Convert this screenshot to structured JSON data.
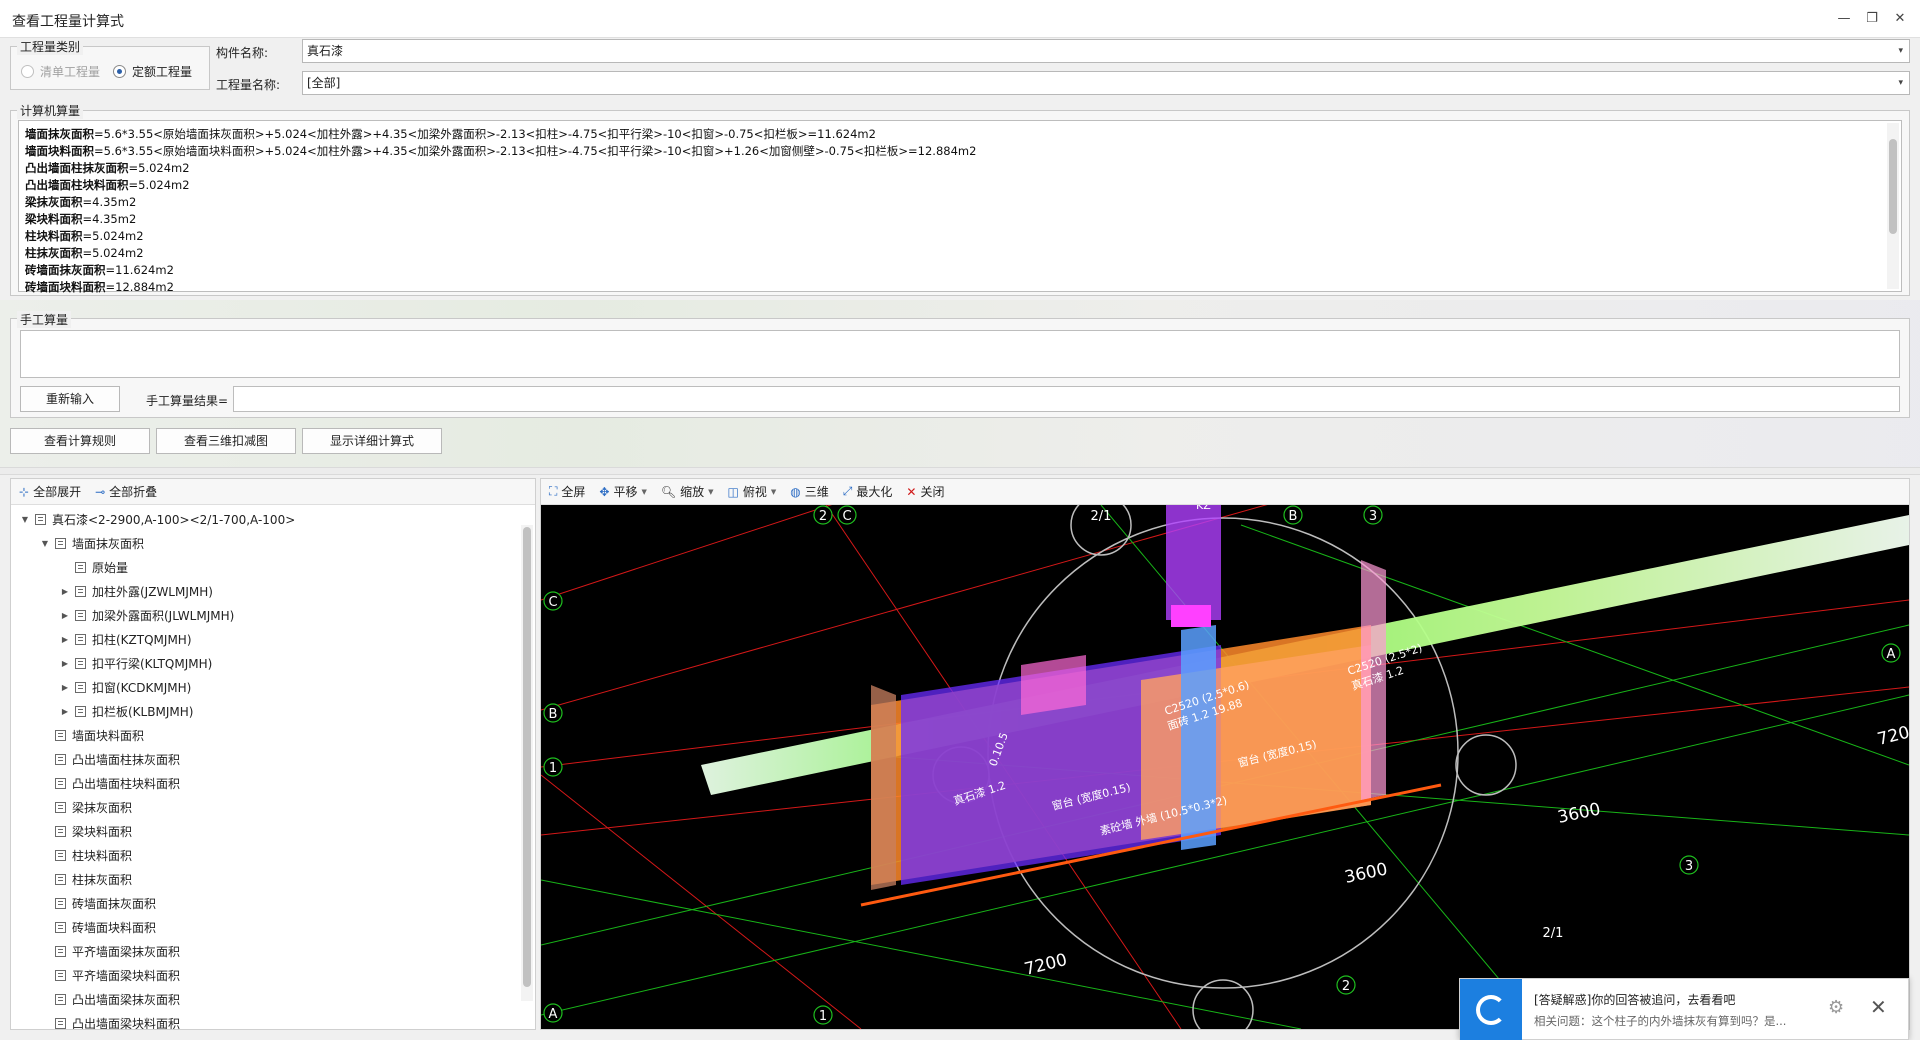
{
  "window": {
    "title": "查看工程量计算式",
    "minimize": "—",
    "restore": "❐",
    "close": "✕"
  },
  "category": {
    "label": "工程量类别",
    "options": [
      {
        "label": "清单工程量",
        "checked": false,
        "enabled": false
      },
      {
        "label": "定额工程量",
        "checked": true,
        "enabled": true
      }
    ]
  },
  "component": {
    "name_label": "构件名称:",
    "name_value": "真石漆",
    "quantity_label": "工程量名称:",
    "quantity_value": "[全部]"
  },
  "computer_calc": {
    "label": "计算机算量",
    "lines": [
      {
        "name": "墙面抹灰面积",
        "expr": "=5.6*3.55<原始墙面抹灰面积>+5.024<加柱外露>+4.35<加梁外露面积>-2.13<扣柱>-4.75<扣平行梁>-10<扣窗>-0.75<扣栏板>=11.624m2"
      },
      {
        "name": "墙面块料面积",
        "expr": "=5.6*3.55<原始墙面块料面积>+5.024<加柱外露>+4.35<加梁外露面积>-2.13<扣柱>-4.75<扣平行梁>-10<扣窗>+1.26<加窗侧壁>-0.75<扣栏板>=12.884m2"
      },
      {
        "name": "凸出墙面柱抹灰面积",
        "expr": "=5.024m2"
      },
      {
        "name": "凸出墙面柱块料面积",
        "expr": "=5.024m2"
      },
      {
        "name": "梁抹灰面积",
        "expr": "=4.35m2"
      },
      {
        "name": "梁块料面积",
        "expr": "=4.35m2"
      },
      {
        "name": "柱块料面积",
        "expr": "=5.024m2"
      },
      {
        "name": "柱抹灰面积",
        "expr": "=5.024m2"
      },
      {
        "name": "砖墙面抹灰面积",
        "expr": "=11.624m2"
      },
      {
        "name": "砖墙面块料面积",
        "expr": "=12.884m2"
      }
    ]
  },
  "manual_calc": {
    "label": "手工算量",
    "reenter": "重新输入",
    "result_label": "手工算量结果="
  },
  "actions": {
    "rules": "查看计算规则",
    "view3d": "查看三维扣减图",
    "detail": "显示详细计算式"
  },
  "tree_toolbar": {
    "expand": "全部展开",
    "collapse": "全部折叠"
  },
  "tree": [
    {
      "label": "真石漆<2-2900,A-100><2/1-700,A-100>",
      "level": 0,
      "expander": "▼"
    },
    {
      "label": "墙面抹灰面积",
      "level": 1,
      "expander": "▼"
    },
    {
      "label": "原始量",
      "level": 2,
      "expander": ""
    },
    {
      "label": "加柱外露(JZWLMJMH)",
      "level": 2,
      "expander": "▶"
    },
    {
      "label": "加梁外露面积(JLWLMJMH)",
      "level": 2,
      "expander": "▶"
    },
    {
      "label": "扣柱(KZTQMJMH)",
      "level": 2,
      "expander": "▶"
    },
    {
      "label": "扣平行梁(KLTQMJMH)",
      "level": 2,
      "expander": "▶"
    },
    {
      "label": "扣窗(KCDKMJMH)",
      "level": 2,
      "expander": "▶"
    },
    {
      "label": "扣栏板(KLBMJMH)",
      "level": 2,
      "expander": "▶"
    },
    {
      "label": "墙面块料面积",
      "level": 1,
      "expander": ""
    },
    {
      "label": "凸出墙面柱抹灰面积",
      "level": 1,
      "expander": ""
    },
    {
      "label": "凸出墙面柱块料面积",
      "level": 1,
      "expander": ""
    },
    {
      "label": "梁抹灰面积",
      "level": 1,
      "expander": ""
    },
    {
      "label": "梁块料面积",
      "level": 1,
      "expander": ""
    },
    {
      "label": "柱块料面积",
      "level": 1,
      "expander": ""
    },
    {
      "label": "柱抹灰面积",
      "level": 1,
      "expander": ""
    },
    {
      "label": "砖墙面抹灰面积",
      "level": 1,
      "expander": ""
    },
    {
      "label": "砖墙面块料面积",
      "level": 1,
      "expander": ""
    },
    {
      "label": "平齐墙面梁抹灰面积",
      "level": 1,
      "expander": ""
    },
    {
      "label": "平齐墙面梁块料面积",
      "level": 1,
      "expander": ""
    },
    {
      "label": "凸出墙面梁抹灰面积",
      "level": 1,
      "expander": ""
    },
    {
      "label": "凸出墙面梁块料面积",
      "level": 1,
      "expander": ""
    }
  ],
  "view_toolbar": {
    "fullscreen": "全屏",
    "pan": "平移",
    "zoom": "缩放",
    "topview": "俯视",
    "view3d": "三维",
    "maximize": "最大化",
    "close": "关闭"
  },
  "scene": {
    "axis_labels": [
      "2",
      "C",
      "2/1",
      "B",
      "3",
      "C",
      "B",
      "1",
      "A",
      "A",
      "1",
      "2",
      "2/1",
      "3"
    ],
    "dimensions": [
      "3600",
      "3600",
      "7200",
      "720"
    ],
    "annotations": [
      "C2520 (2.5*2)",
      "真石漆 1.2",
      "C2520 (2.5*0.6)",
      "面砖 1.2  19.88",
      "窗台 (宽度0.15)",
      "窗台 (宽度0.15)",
      "真石漆 1.2",
      "0.10.5",
      "素砼墙 外墙 (10.5*0.3*2)",
      "KZ"
    ]
  },
  "toast": {
    "title": "[答疑解惑]你的回答被追问，去看看吧",
    "subtitle": "相关问题：这个柱子的内外墙抹灰有算到吗？是..."
  }
}
